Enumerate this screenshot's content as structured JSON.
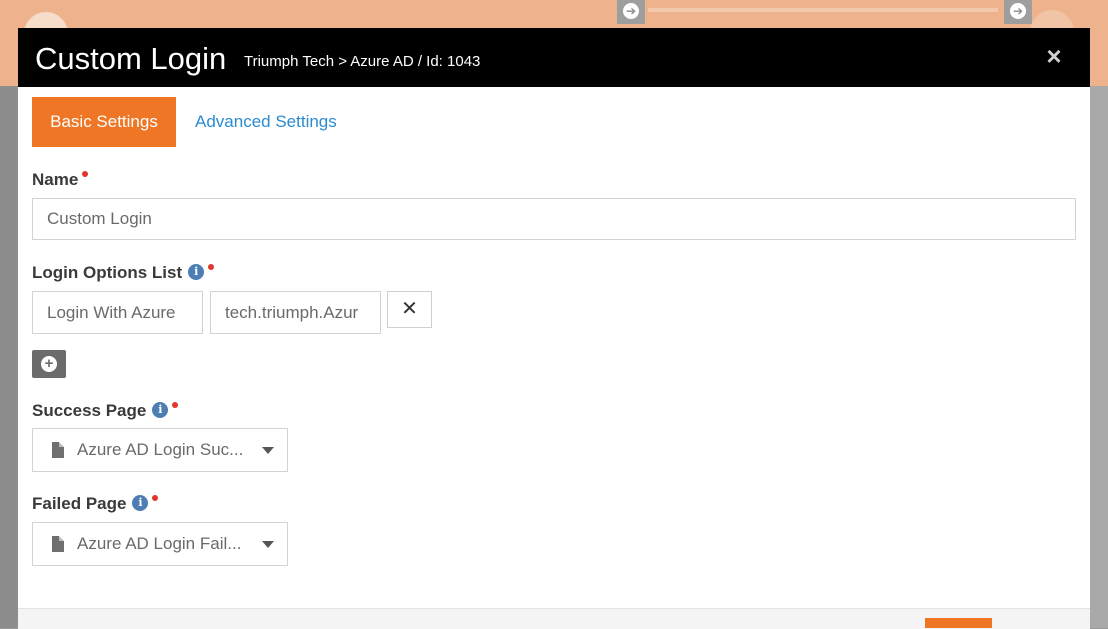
{
  "modal": {
    "title": "Custom Login",
    "subtitle": "Triumph Tech > Azure AD / Id: 1043",
    "close_glyph": "×"
  },
  "tabs": [
    {
      "label": "Basic Settings",
      "active": true
    },
    {
      "label": "Advanced Settings",
      "active": false
    }
  ],
  "fields": {
    "name": {
      "label": "Name",
      "value": "Custom Login",
      "required": true
    },
    "login_options": {
      "label": "Login Options List",
      "required": true,
      "has_help": true,
      "key_value": "Login With Azure",
      "value_value": "tech.triumph.Azur",
      "remove_glyph": "✕",
      "add_icon": "plus-circle-icon"
    },
    "success_page": {
      "label": "Success Page",
      "required": true,
      "has_help": true,
      "value": "Azure AD Login Suc...",
      "icon": "file-icon"
    },
    "failed_page": {
      "label": "Failed Page",
      "required": true,
      "has_help": true,
      "value": "Azure AD Login Fail...",
      "icon": "file-icon"
    }
  },
  "colors": {
    "accent": "#ee7625",
    "link": "#2b8bd0",
    "required_dot": "#e0362c",
    "info_icon": "#4d7eb3",
    "header_bg": "#000000"
  }
}
